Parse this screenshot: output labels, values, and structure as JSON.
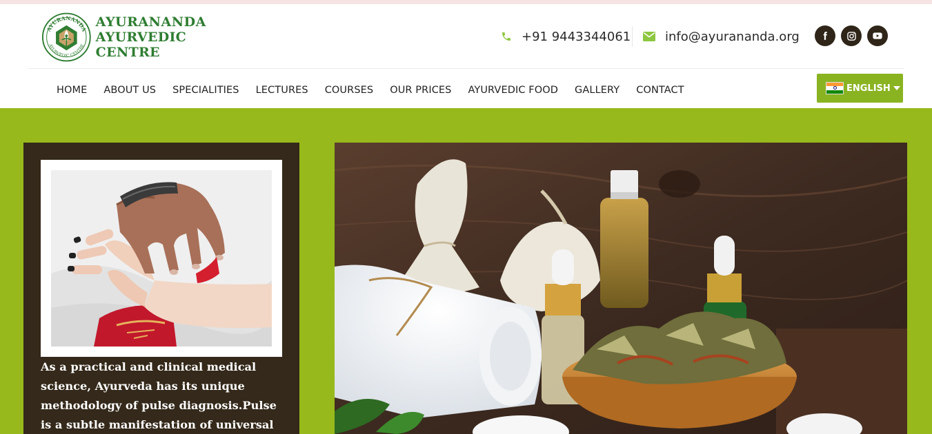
{
  "brand": {
    "name_line1": "AYURANANDA",
    "name_line2": "AYURVEDIC CENTRE",
    "emblem_top": "AYURANANDA",
    "emblem_bottom": "AYURVEDIC CENTRE"
  },
  "contact": {
    "phone": "+91 9443344061",
    "email": "info@ayurananda.org"
  },
  "social": [
    {
      "icon": "facebook-icon",
      "glyph": "f"
    },
    {
      "icon": "instagram-icon"
    },
    {
      "icon": "youtube-icon"
    }
  ],
  "nav": {
    "items": [
      {
        "label": "HOME"
      },
      {
        "label": "ABOUT US"
      },
      {
        "label": "SPECIALITIES"
      },
      {
        "label": "LECTURES"
      },
      {
        "label": "COURSES"
      },
      {
        "label": "OUR PRICES"
      },
      {
        "label": "AYURVEDIC FOOD"
      },
      {
        "label": "GALLERY"
      },
      {
        "label": "CONTACT"
      }
    ]
  },
  "language": {
    "selected": "ENGLISH",
    "flag": "india-flag-icon"
  },
  "card": {
    "text": "As a practical and clinical medical science, Ayurveda has its unique methodology of pulse diagnosis.Pulse is a subtle manifestation of universal consciousness"
  },
  "colors": {
    "brand_green": "#2f7d32",
    "accent_green": "#98b91b",
    "button_green": "#8ab322",
    "icon_green": "#8dc641",
    "card_brown": "#34291a",
    "social_dark": "#2f2518"
  }
}
